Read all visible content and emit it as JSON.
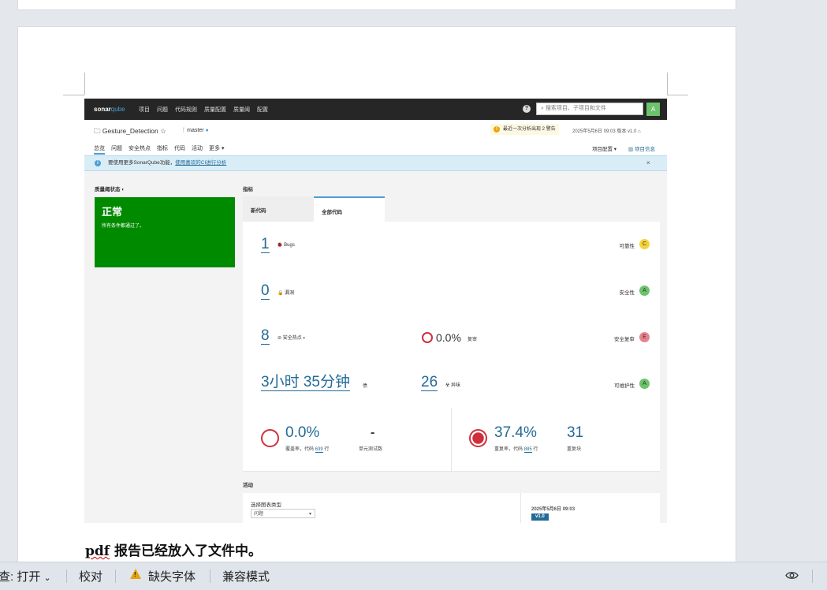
{
  "sonar": {
    "logo_main": "sonar",
    "logo_sub": "qube",
    "nav": [
      "项目",
      "问题",
      "代码规则",
      "质量配置",
      "质量阈",
      "配置"
    ],
    "help": "?",
    "search_placeholder": "搜索项目、子项目和文件",
    "avatar": "A",
    "project_name": "Gesture_Detection",
    "branch": "master",
    "warning_text": "最近一次分析出现 2 警告",
    "analysis_date": "2025年5月6日 09:03  版本 v1.0",
    "tabs": [
      "总览",
      "问题",
      "安全热点",
      "指标",
      "代码",
      "活动",
      "更多 ▾"
    ],
    "project_config": "项目配置 ▾",
    "project_info": "▥ 项目信息",
    "info_text": "要使用更多SonarQube功能，",
    "info_link": "使用喜欢的CI进行分析",
    "close": "×",
    "quality_gate_label": "质量阈状态",
    "quality_gate_status": "正常",
    "quality_gate_sub": "所有条件都通过了。",
    "metrics_label": "指标",
    "tab_new_code": "新代码",
    "tab_all_code": "全部代码",
    "bugs_value": "1",
    "bugs_label": "Bugs",
    "reliability_label": "可靠性",
    "reliability_rating": "C",
    "vuln_value": "0",
    "vuln_label": "漏洞",
    "security_label": "安全性",
    "security_rating": "A",
    "hotspots_value": "8",
    "hotspots_label": "安全热点",
    "reviewed_value": "0.0%",
    "reviewed_label": "复审",
    "security_review_label": "安全复审",
    "security_review_rating": "E",
    "debt_value": "3小时 35分钟",
    "debt_label": "债",
    "smells_value": "26",
    "smells_label": "异味",
    "maintainability_label": "可维护性",
    "maintainability_rating": "A",
    "coverage_value": "0.0%",
    "coverage_label_pre": "覆盖率，代码",
    "coverage_lines": "639",
    "coverage_label_post": "行",
    "unit_tests_value": "-",
    "unit_tests_label": "单元测试数",
    "dup_value": "37.4%",
    "dup_label_pre": "重复率，代码",
    "dup_lines": "885",
    "dup_label_post": "行",
    "dup_blocks_value": "31",
    "dup_blocks_label": "重复块",
    "activity_label": "活动",
    "chart_type_label": "选择图表类型",
    "chart_type_value": "问题",
    "activity_date": "2025年5月6日 09:03",
    "activity_version": "v1.0",
    "colors": {
      "passed": "#008a00",
      "link": "#236a97",
      "rating_a": "#6cc36c",
      "rating_c": "#f5d33b",
      "rating_e": "#e7838b"
    }
  },
  "document": {
    "text_pdf": "pdf",
    "text_rest": " 报告已经放入了文件中。"
  },
  "statusbar": {
    "check": "查: 打开",
    "proofread": "校对",
    "missing_fonts": "缺失字体",
    "compat_mode": "兼容模式"
  }
}
